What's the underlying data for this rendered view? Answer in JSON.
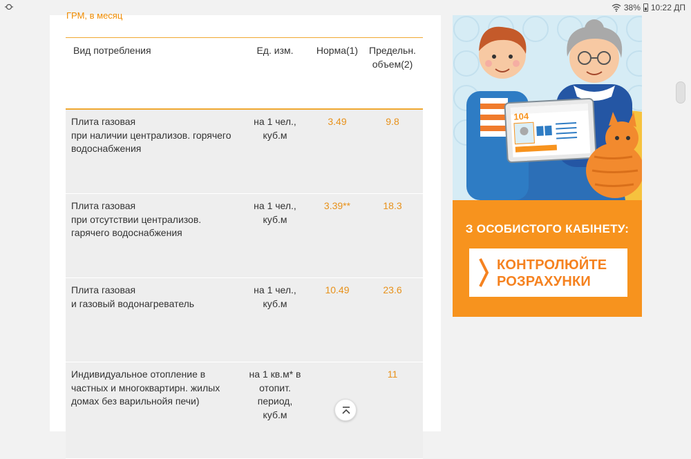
{
  "status_bar": {
    "battery": "38%",
    "time": "10:22 ДП"
  },
  "section": {
    "heading": "ГРМ, в месяц"
  },
  "table": {
    "headers": {
      "type": "Вид потребления",
      "unit": "Ед. изм.",
      "norm": "Норма(1)",
      "max_line1": "Предельн.",
      "max_line2": "объем(2)"
    },
    "rows": [
      {
        "type": [
          "Плита газовая",
          "при наличии централизов. горячего",
          "водоснабжения"
        ],
        "unit": [
          "на 1 чел.,",
          "куб.м"
        ],
        "norm": "3.49",
        "max": "9.8"
      },
      {
        "type": [
          "Плита газовая",
          "при отсутствии централизов.",
          "гарячего водоснабжения"
        ],
        "unit": [
          "на 1 чел.,",
          "куб.м"
        ],
        "norm": "3.39**",
        "max": "18.3"
      },
      {
        "type": [
          "Плита газовая",
          "и газовый водонагреватель"
        ],
        "unit": [
          "на 1 чел.,",
          "куб.м"
        ],
        "norm": "10.49",
        "max": "23.6"
      },
      {
        "type": [
          "Индивидуальное отопление в",
          "частных и многоквартирн. жилых",
          "домах без варильнойя печи)"
        ],
        "unit": [
          "на 1 кв.м* в",
          "отопит.",
          "период,",
          "куб.м"
        ],
        "norm": "",
        "max": "11"
      }
    ]
  },
  "banner": {
    "tablet_number": "104",
    "heading": "З ОСОБИСТОГО КАБІНЕТУ:",
    "button_line1": "КОНТРОЛЮЙТЕ",
    "button_line2": "РОЗРАХУНКИ"
  },
  "colors": {
    "accent": "#f08c00",
    "value": "#e8911a",
    "banner_orange": "#f7931e",
    "row_bg": "#eeeeee"
  }
}
